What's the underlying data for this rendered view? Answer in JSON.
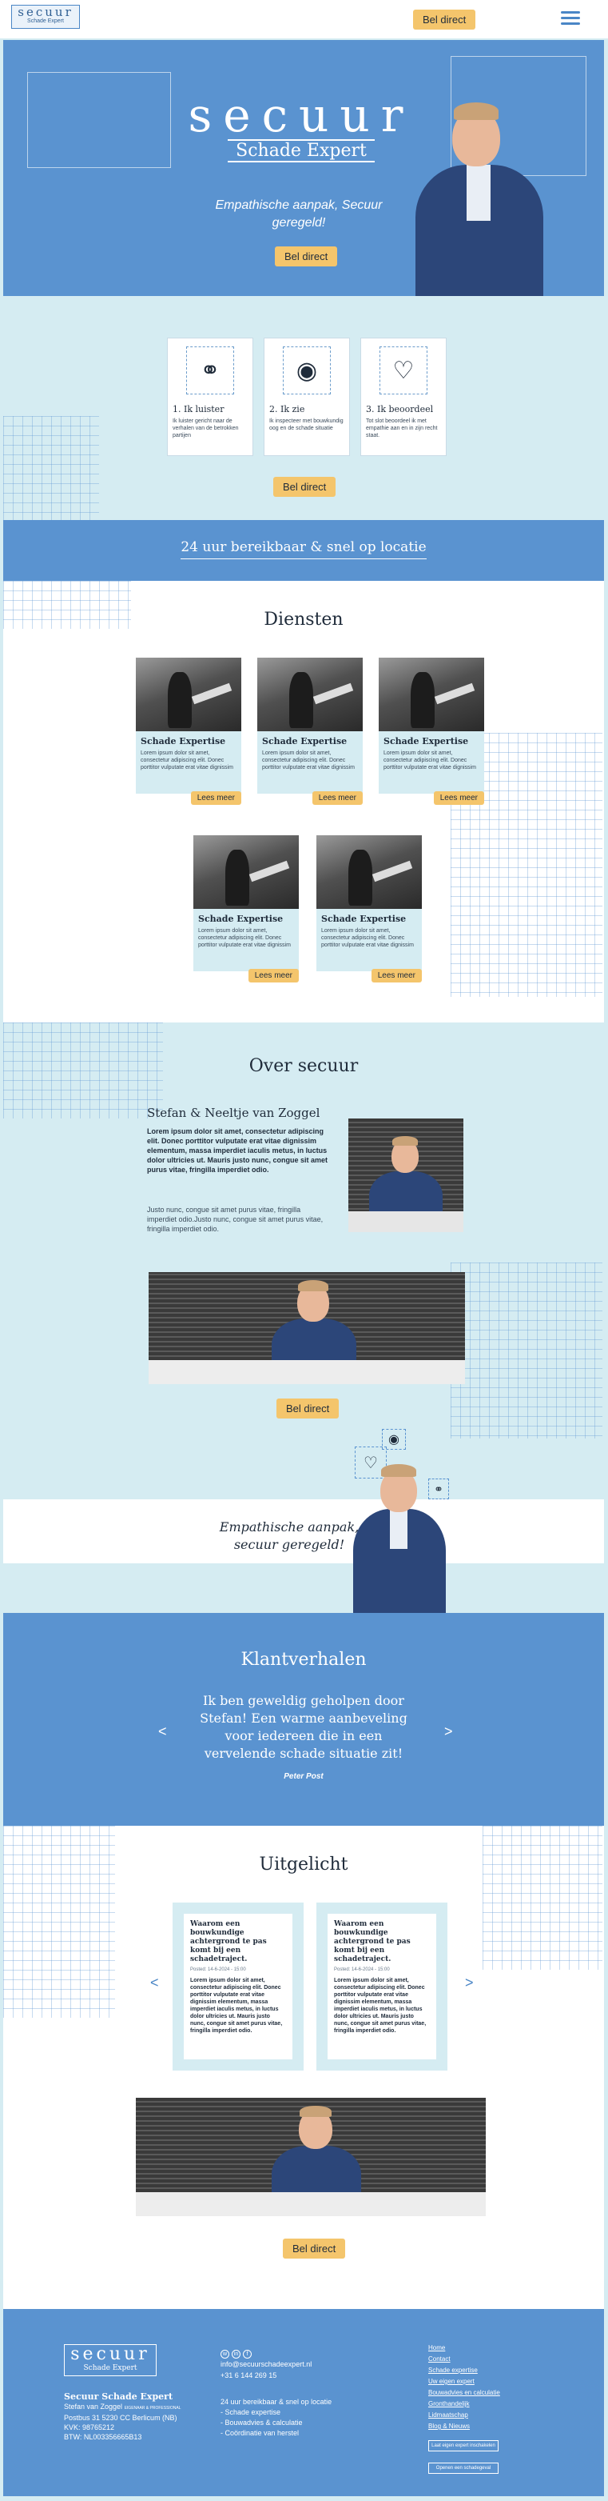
{
  "header": {
    "logo_line1": "secuur",
    "logo_line2": "Schade Expert",
    "cta": "Bel direct"
  },
  "hero": {
    "logo_line1": "secuur",
    "logo_line2": "Schade Expert",
    "tagline": "Empathische aanpak, Secuur geregeld!",
    "cta": "Bel direct"
  },
  "steps": {
    "items": [
      {
        "title": "1. Ik luister",
        "text": "Ik luister gericht naar de verhalen van de betrokken partijen",
        "icon": "ear-icon"
      },
      {
        "title": "2. Ik zie",
        "text": "Ik inspecteer met bouwkundig oog en de schade situatie",
        "icon": "eye-icon"
      },
      {
        "title": "3. Ik beoordeel",
        "text": "Tot slot beoordeel ik met empathie aan en in zijn recht staat.",
        "icon": "heart-icon"
      }
    ],
    "cta": "Bel direct"
  },
  "band": {
    "text": "24 uur bereikbaar & snel op locatie"
  },
  "services": {
    "title": "Diensten",
    "cards": [
      {
        "title": "Schade Expertise",
        "text": "Lorem ipsum dolor sit amet, consectetur adipiscing elit. Donec porttitor vulputate erat vitae dignissim",
        "cta": "Lees meer"
      },
      {
        "title": "Schade Expertise",
        "text": "Lorem ipsum dolor sit amet, consectetur adipiscing elit. Donec porttitor vulputate erat vitae dignissim",
        "cta": "Lees meer"
      },
      {
        "title": "Schade Expertise",
        "text": "Lorem ipsum dolor sit amet, consectetur adipiscing elit. Donec porttitor vulputate erat vitae dignissim",
        "cta": "Lees meer"
      },
      {
        "title": "Schade Expertise",
        "text": "Lorem ipsum dolor sit amet, consectetur adipiscing elit. Donec porttitor vulputate erat vitae dignissim",
        "cta": "Lees meer"
      },
      {
        "title": "Schade Expertise",
        "text": "Lorem ipsum dolor sit amet, consectetur adipiscing elit. Donec porttitor vulputate erat vitae dignissim",
        "cta": "Lees meer"
      }
    ]
  },
  "about": {
    "title": "Over secuur",
    "name": "Stefan & Neeltje van Zoggel",
    "bold_text": "Lorem ipsum dolor sit amet, consectetur adipiscing elit. Donec porttitor vulputate erat vitae dignissim elementum, massa imperdiet iaculis metus, in luctus dolor ultricies ut. Mauris justo nunc, congue sit amet purus vitae, fringilla imperdiet odio.",
    "text": "Justo nunc, congue sit amet purus vitae, fringilla imperdiet odio.Justo nunc, congue sit amet purus vitae, fringilla imperdiet odio.",
    "cta": "Bel direct"
  },
  "tagline_band": {
    "text": "Empathische aanpak, secuur geregeld!"
  },
  "testimonials": {
    "title": "Klantverhalen",
    "quote": "Ik ben geweldig geholpen door Stefan! Een warme aanbeveling voor iedereen die in een vervelende schade situatie zit!",
    "author": "Peter Post",
    "prev": "<",
    "next": ">"
  },
  "featured": {
    "title": "Uitgelicht",
    "posts": [
      {
        "title": "Waarom een bouwkundige achtergrond te pas komt bij een schadetraject.",
        "date": "Posted: 14-6-2024 - 15:00",
        "text": "Lorem ipsum dolor sit amet, consectetur adipiscing elit. Donec porttitor vulputate erat vitae dignissim elementum, massa imperdiet iaculis metus, in luctus dolor ultricies ut. Mauris justo nunc, congue sit amet purus vitae, fringilla imperdiet odio."
      },
      {
        "title": "Waarom een bouwkundige achtergrond te pas komt bij een schadetraject.",
        "date": "Posted: 14-6-2024 - 15:00",
        "text": "Lorem ipsum dolor sit amet, consectetur adipiscing elit. Donec porttitor vulputate erat vitae dignissim elementum, massa imperdiet iaculis metus, in luctus dolor ultricies ut. Mauris justo nunc, congue sit amet purus vitae, fringilla imperdiet odio."
      }
    ],
    "prev": "<",
    "next": ">",
    "cta": "Bel direct"
  },
  "footer": {
    "logo_line1": "secuur",
    "logo_line2": "Schade Expert",
    "company": "Secuur Schade Expert",
    "owner": "Stefan van Zoggel",
    "owner_suffix": "EIGENAAR & PROFESSIONAL",
    "address": "Postbus 31 5230 CC Berlicum (NB)",
    "kvk": "KVK: 98765212",
    "btw": "BTW: NL003356665B13",
    "email": "info@secuurschadeexpert.nl",
    "phone": "+31 6 144 269 15",
    "services": [
      "24 uur bereikbaar & snel op locatie",
      "- Schade expertise",
      "- Bouwadvies & calculatie",
      "- Coördinatie van herstel"
    ],
    "links": [
      "Home",
      "Contact",
      "Schade expertise",
      "Uw eigen expert",
      "Bouwadvies en calculatie",
      "Gronthandelijk",
      "Lidmaatschap",
      "Blog & Nieuws"
    ],
    "btn1": "Laat eigen expert inschakelen",
    "btn2": "Openen een schadegeval"
  }
}
